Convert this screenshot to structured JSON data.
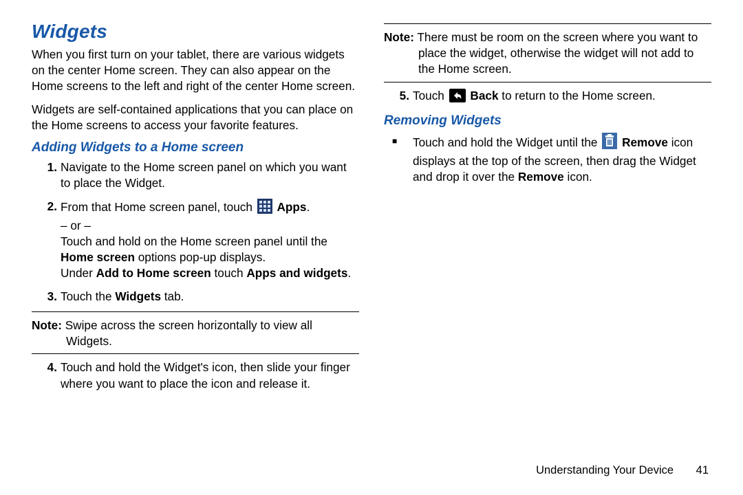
{
  "leftCol": {
    "h1": "Widgets",
    "p1": "When you first turn on your tablet, there are various widgets on the center Home screen. They can also appear on the Home screens to the left and right of the center Home screen.",
    "p2": "Widgets are self-contained applications that you can place on the Home screens to access your favorite features.",
    "h2": "Adding Widgets to a Home screen",
    "step1": "Navigate to the Home screen panel on which you want to place the Widget.",
    "step2a": "From that Home screen panel, touch ",
    "step2apps": "Apps",
    "step2end": ".",
    "step2or": "– or –",
    "step2b1": "Touch and hold on the Home screen panel until the ",
    "step2b1b": "Home screen",
    "step2b1c": " options pop-up displays.",
    "step2c1": "Under ",
    "step2c1b": "Add to Home screen",
    "step2c1c": " touch ",
    "step2c1d": "Apps and widgets",
    "step2c1e": ".",
    "step3a": "Touch the ",
    "step3b": "Widgets",
    "step3c": " tab.",
    "noteL_lbl": "Note:",
    "noteL_txt": " Swipe across the screen horizontally to view all Widgets.",
    "step4": "Touch and hold the Widget's icon, then slide your finger where you want to place the icon and release it."
  },
  "rightCol": {
    "noteR_lbl": "Note:",
    "noteR_txt": " There must be room on the screen where you want to place the widget, otherwise the widget will not add to the Home screen.",
    "step5a": "Touch ",
    "step5b": "Back",
    "step5c": " to return to the Home screen.",
    "h2": "Removing Widgets",
    "rem_a": "Touch and hold the Widget until the ",
    "rem_b": "Remove",
    "rem_c": " icon displays at the top of the screen, then drag the Widget and drop it over the ",
    "rem_d": "Remove",
    "rem_e": " icon."
  },
  "footer": {
    "section": "Understanding Your Device",
    "page": "41"
  },
  "nums": {
    "n1": "1.",
    "n2": "2.",
    "n3": "3.",
    "n4": "4.",
    "n5": "5."
  },
  "icons": {
    "apps": "apps-grid-icon",
    "back": "back-icon",
    "remove": "remove-trash-icon"
  }
}
